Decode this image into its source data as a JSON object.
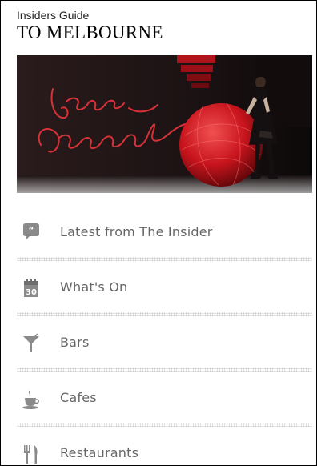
{
  "header": {
    "subtitle": "Insiders Guide",
    "title": "TO MELBOURNE"
  },
  "hero": {
    "script_text": "Lose Yourself"
  },
  "menu": {
    "items": [
      {
        "label": "Latest from The Insider",
        "icon": "speech-bubble-icon"
      },
      {
        "label": "What's On",
        "icon": "calendar-icon",
        "icon_text": "30"
      },
      {
        "label": "Bars",
        "icon": "cocktail-icon"
      },
      {
        "label": "Cafes",
        "icon": "coffee-cup-icon"
      },
      {
        "label": "Restaurants",
        "icon": "cutlery-icon"
      }
    ]
  },
  "colors": {
    "icon": "#8a8a8a",
    "label": "#666666",
    "accent_red": "#d4262d"
  }
}
